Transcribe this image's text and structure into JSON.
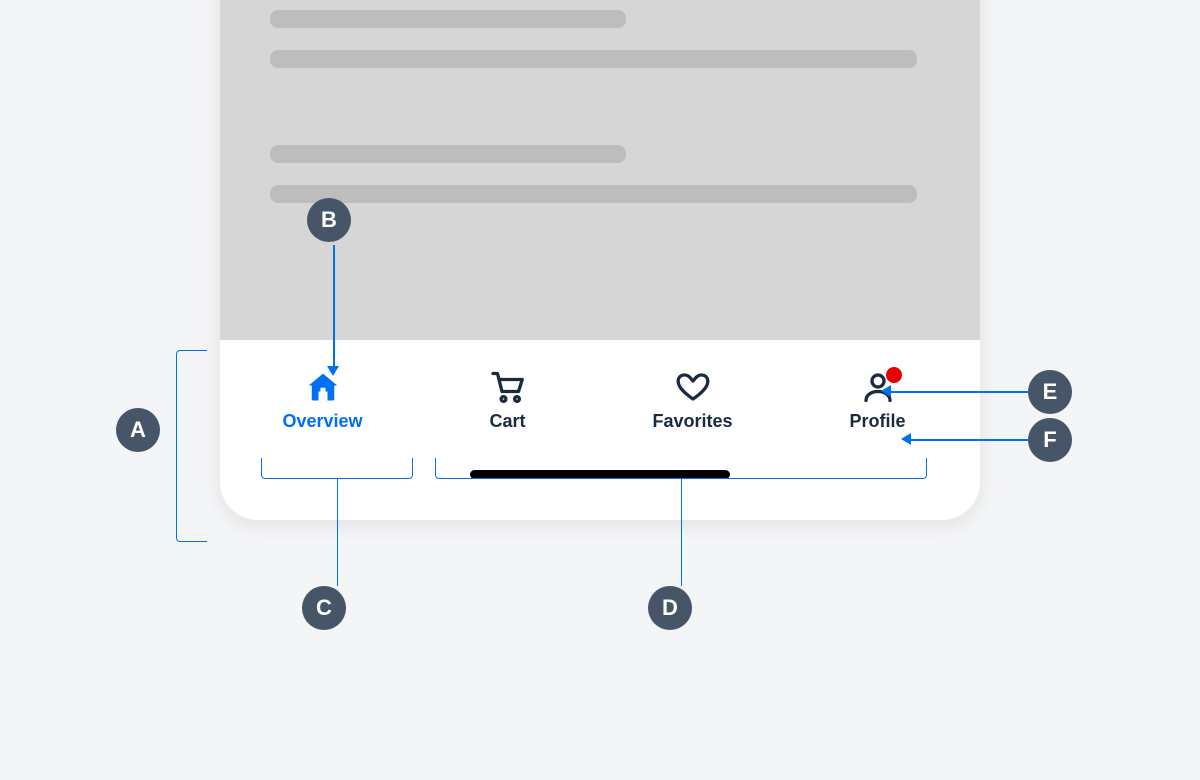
{
  "tabbar": {
    "items": [
      {
        "label": "Overview",
        "icon": "home-icon",
        "active": true,
        "badge": false
      },
      {
        "label": "Cart",
        "icon": "cart-icon",
        "active": false,
        "badge": false
      },
      {
        "label": "Favorites",
        "icon": "heart-icon",
        "active": false,
        "badge": false
      },
      {
        "label": "Profile",
        "icon": "person-icon",
        "active": false,
        "badge": true
      }
    ]
  },
  "annotations": {
    "A": "A",
    "B": "B",
    "C": "C",
    "D": "D",
    "E": "E",
    "F": "F"
  },
  "colors": {
    "active": "#0070f2",
    "inactive": "#1a2a41",
    "badge": "#e60000",
    "annotation_circle": "#475569",
    "annotation_line": "#0070f2"
  }
}
